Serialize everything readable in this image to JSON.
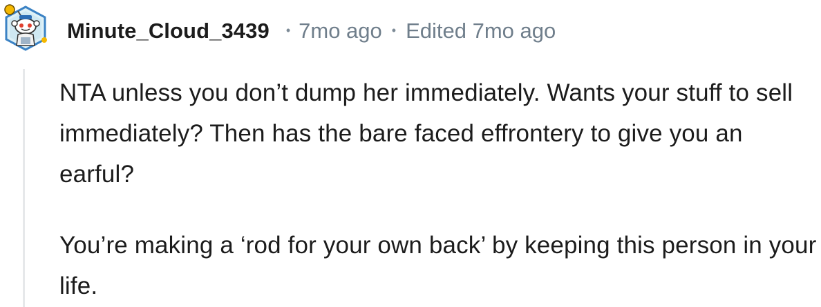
{
  "comment": {
    "author": "Minute_Cloud_3439",
    "separator": "•",
    "posted": "7mo ago",
    "edited": "Edited 7mo ago",
    "paragraphs": [
      "NTA unless you don’t dump her immediately. Wants your stuff to sell immediately? Then has the bare faced effrontery to give you an earful?",
      "You’re making a ‘rod for your own back’ by keeping this person in your life."
    ]
  },
  "colors": {
    "meta_text": "#6f7e8b",
    "body_text": "#1c1c1c",
    "thread_line": "#e6e8ea",
    "avatar_ring": "#3b82c4",
    "avatar_accent": "#f5b800"
  },
  "icons": {
    "avatar": "snoo-avatar-icon"
  }
}
